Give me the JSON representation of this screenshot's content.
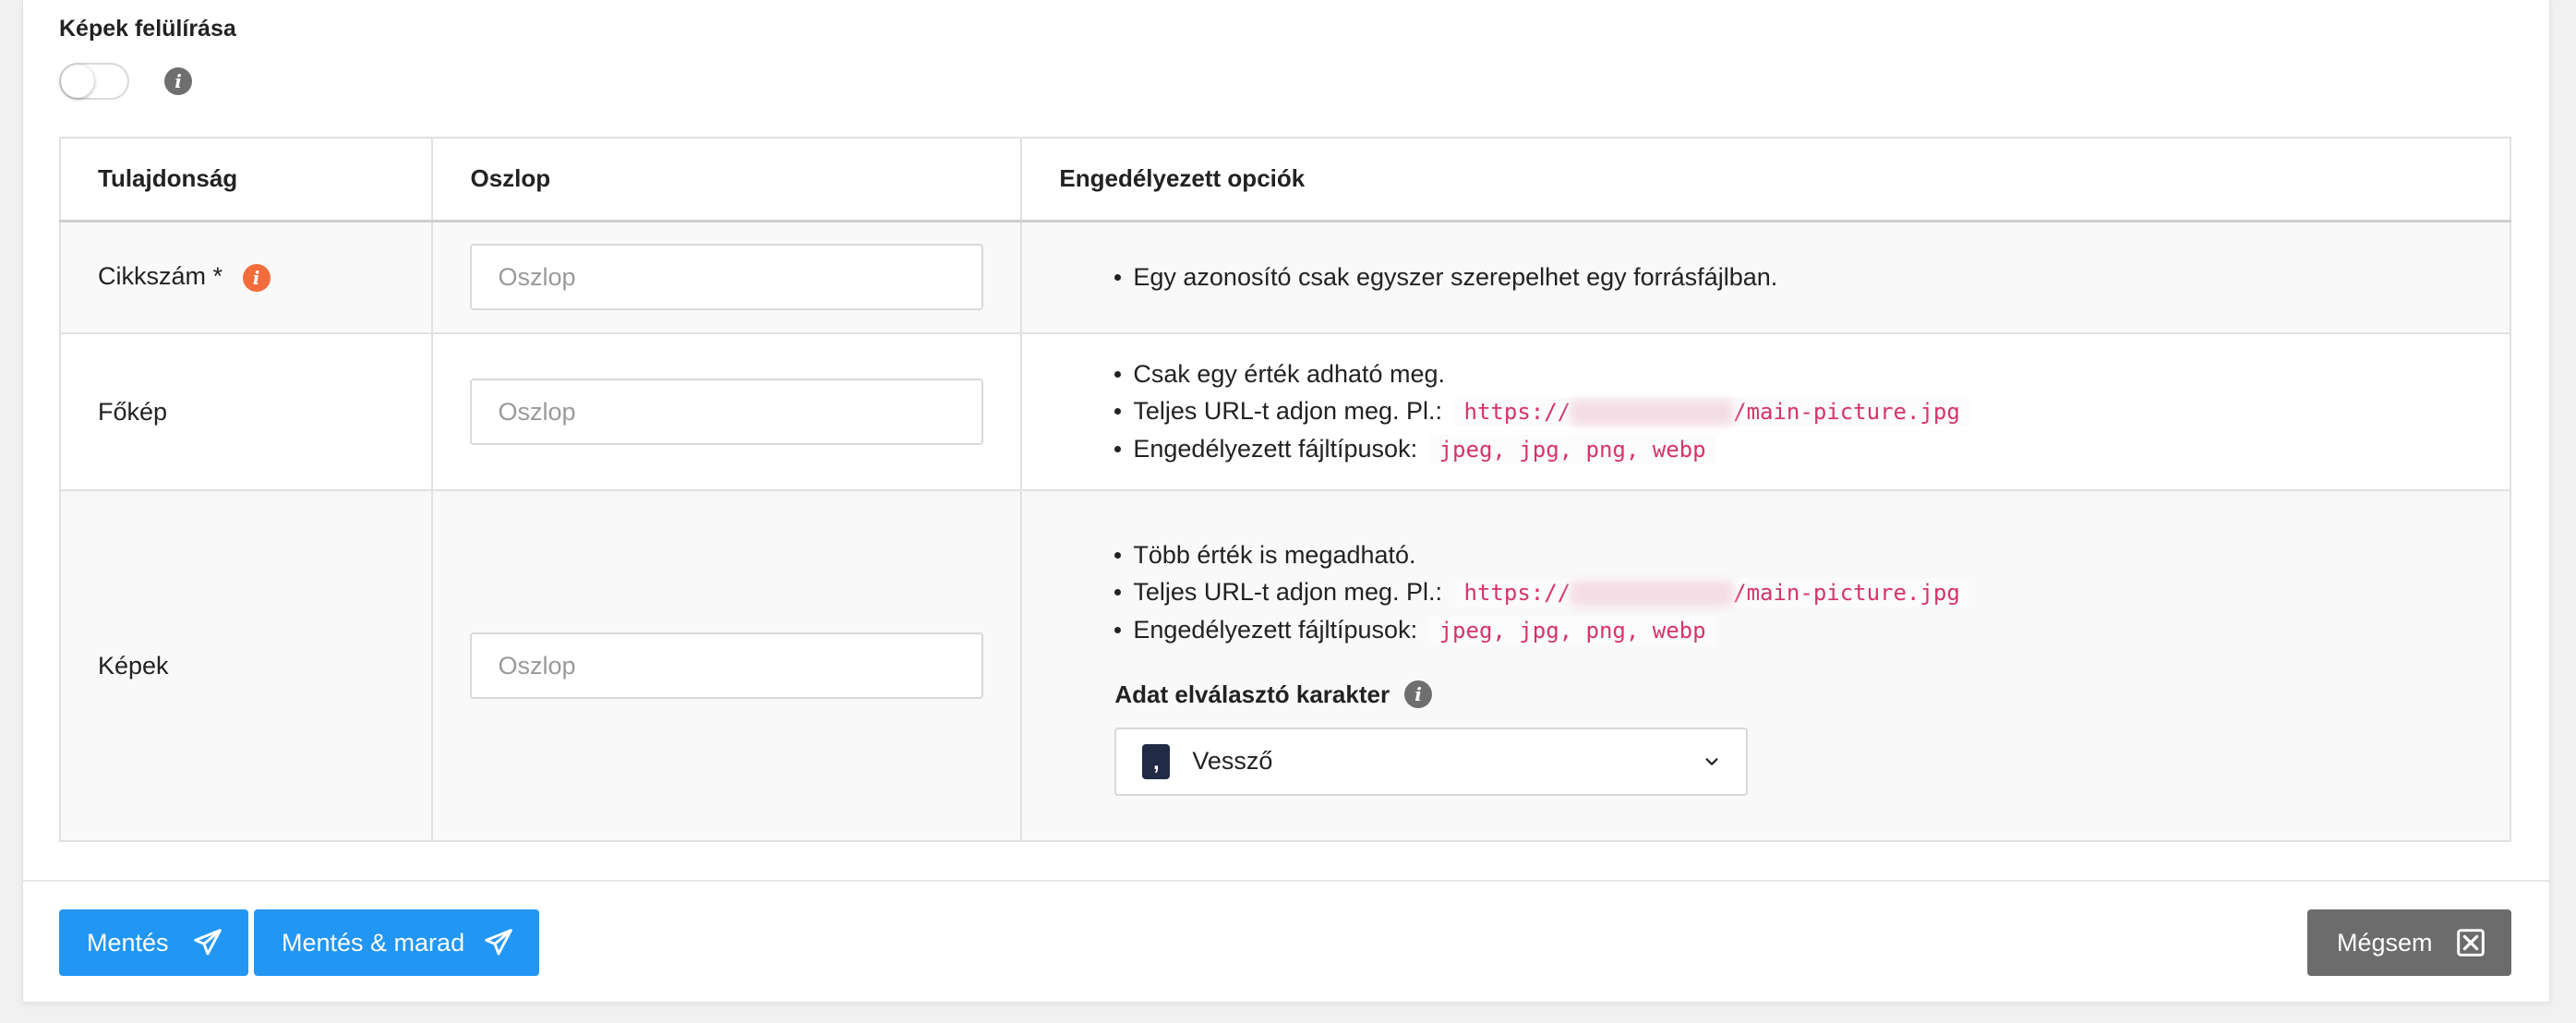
{
  "overwrite": {
    "label": "Képek felülírása",
    "enabled": false,
    "info_icon": "info-icon"
  },
  "table": {
    "headers": [
      "Tulajdonság",
      "Oszlop",
      "Engedélyezett opciók"
    ],
    "rows": [
      {
        "property": "Cikkszám *",
        "column_placeholder": "Oszlop",
        "column_value": "",
        "options": [
          "Egy azonosító csak egyszer szerepelhet egy forrásfájlban."
        ]
      },
      {
        "property": "Főkép",
        "column_placeholder": "Oszlop",
        "column_value": "",
        "options": [
          "Csak egy érték adható meg.",
          "Teljes URL-t adjon meg. Pl.:",
          "Engedélyezett fájltípusok:"
        ],
        "url_prefix": "https://",
        "url_suffix": "/main-picture.jpg",
        "file_types": "jpeg, jpg, png, webp"
      },
      {
        "property": "Képek",
        "column_placeholder": "Oszlop",
        "column_value": "",
        "options": [
          "Több érték is megadható.",
          "Teljes URL-t adjon meg. Pl.:",
          "Engedélyezett fájltípusok:"
        ],
        "url_prefix": "https://",
        "url_suffix": "/main-picture.jpg",
        "file_types": "jpeg, jpg, png, webp",
        "separator": {
          "label": "Adat elválasztó karakter",
          "chip": ",",
          "selected": "Vessző"
        }
      }
    ]
  },
  "buttons": {
    "save": "Mentés",
    "save_stay": "Mentés & marad",
    "cancel": "Mégsem"
  },
  "colors": {
    "primary": "#2196f3",
    "secondary": "#6c6c6c",
    "required_info": "#f26c3c",
    "code": "#d6336c"
  }
}
